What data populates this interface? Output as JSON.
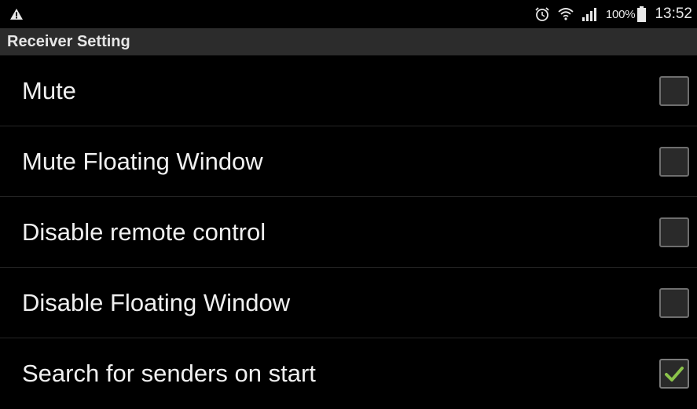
{
  "status_bar": {
    "left_icon": "warning-icon",
    "icons": [
      "alarm-icon",
      "wifi-icon",
      "signal-icon",
      "battery-icon"
    ],
    "battery_percent": "100%",
    "time": "13:52"
  },
  "title_bar": {
    "title": "Receiver Setting"
  },
  "settings": [
    {
      "label": "Mute",
      "checked": false
    },
    {
      "label": "Mute Floating Window",
      "checked": false
    },
    {
      "label": "Disable remote control",
      "checked": false
    },
    {
      "label": "Disable Floating Window",
      "checked": false
    },
    {
      "label": "Search for senders on start",
      "checked": true
    }
  ],
  "colors": {
    "background": "#000000",
    "title_bar": "#2c2c2c",
    "check_accent": "#8bc34a"
  }
}
